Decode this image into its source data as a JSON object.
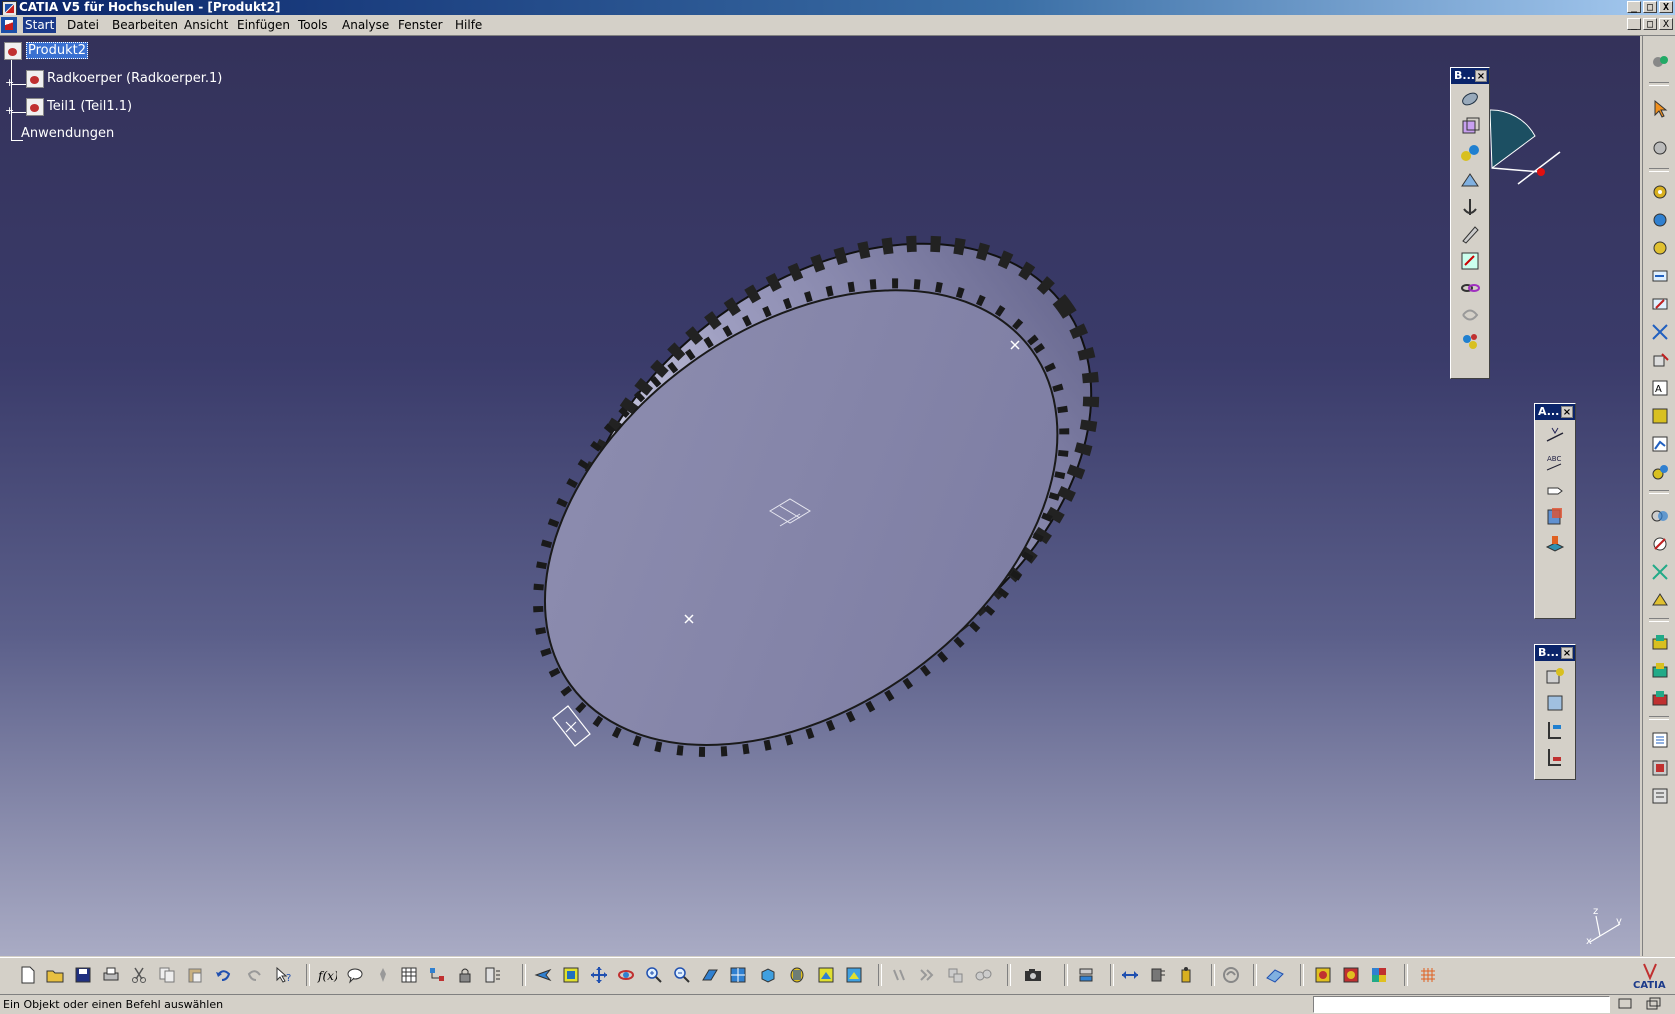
{
  "window": {
    "title": "CATIA V5 für Hochschulen - [Produkt2]",
    "buttons": [
      "_",
      "□",
      "X"
    ],
    "doc_buttons": [
      "_",
      "□",
      "X"
    ]
  },
  "menu": {
    "items": [
      "Start",
      "Datei",
      "Bearbeiten",
      "Ansicht",
      "Einfügen",
      "Tools",
      "Analyse",
      "Fenster",
      "Hilfe"
    ]
  },
  "tree": {
    "root": "Produkt2",
    "children": [
      "Radkoerper (Radkoerper.1)",
      "Teil1 (Teil1.1)"
    ],
    "applications": "Anwendungen"
  },
  "panels": {
    "panel1_title": "B...",
    "panel2_title": "A...",
    "panel3_title": "B..."
  },
  "compass": {
    "axis_x": "x",
    "axis_y": "y",
    "axis_z": "z"
  },
  "brand": "CATIA",
  "status": {
    "message": "Ein Objekt oder einen Befehl auswählen",
    "command_input": ""
  },
  "colors": {
    "viewport_top": "#34325a",
    "viewport_bottom": "#a9abc4",
    "selection": "#3a70d0",
    "title": "#0a246a"
  }
}
